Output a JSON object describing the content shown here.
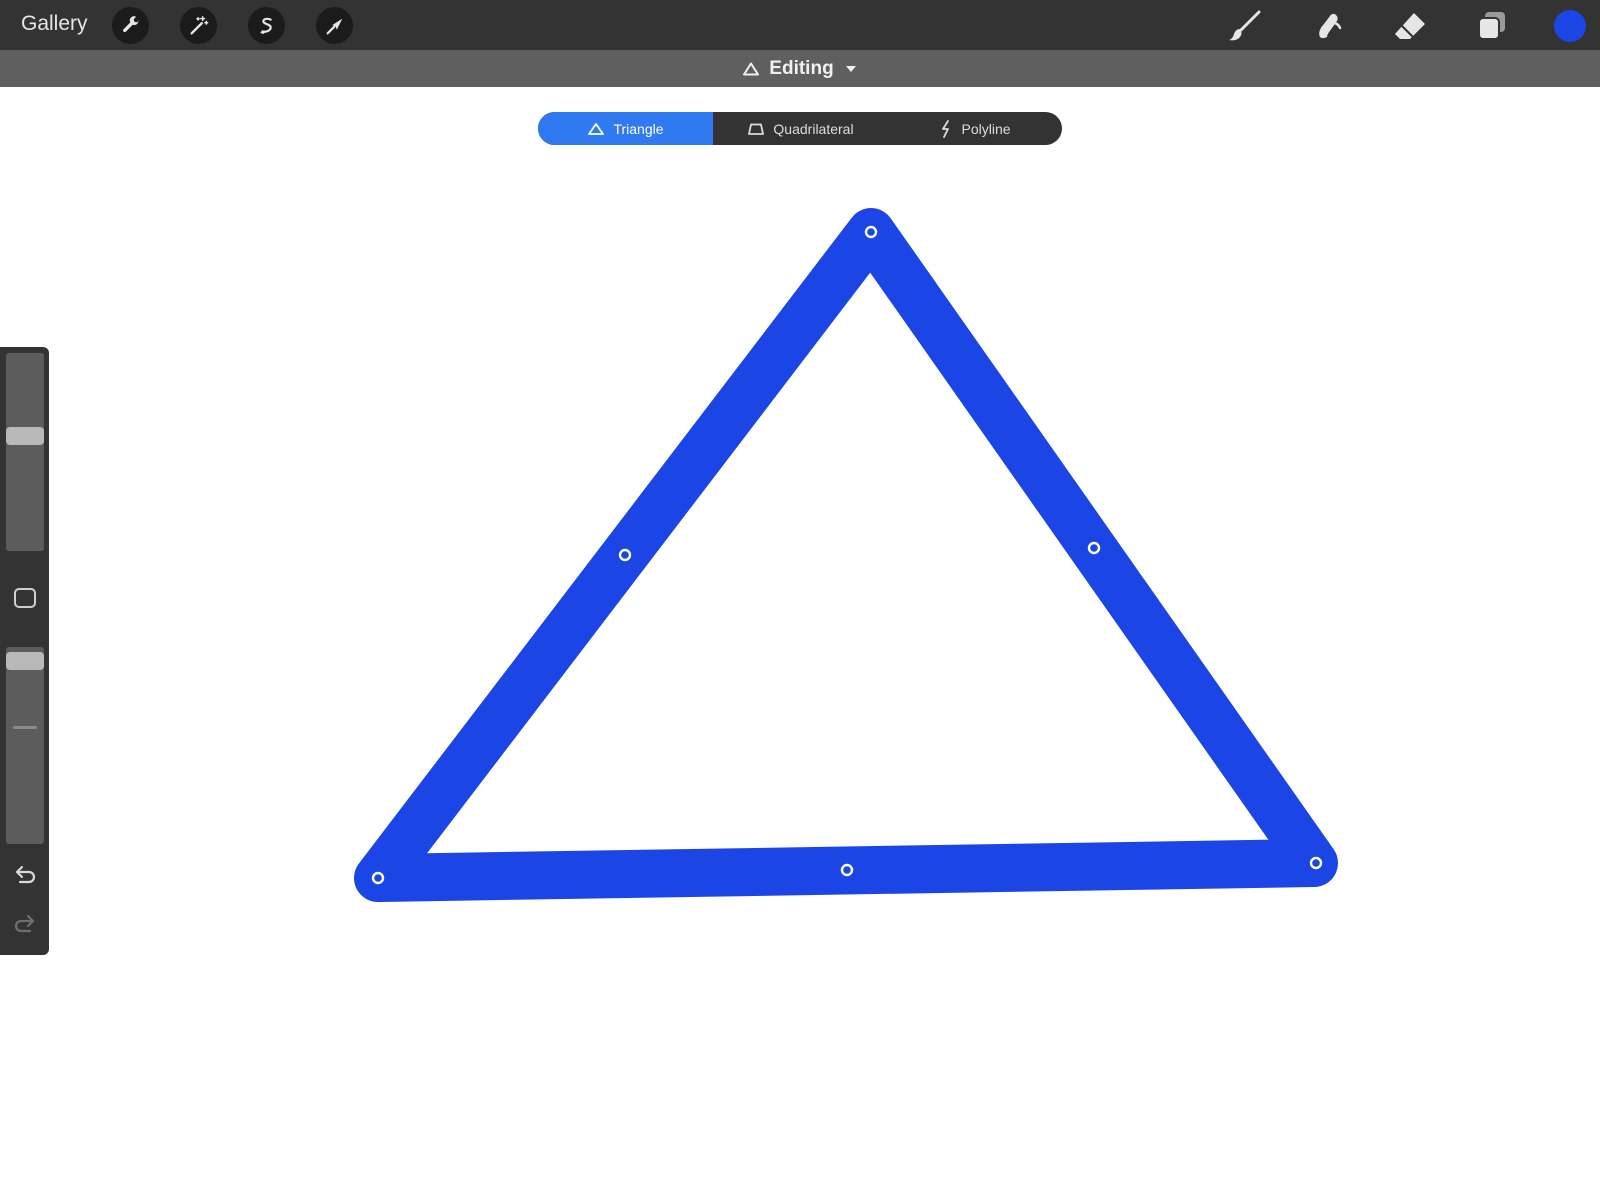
{
  "app": {
    "gallery_label": "Gallery"
  },
  "toolbar_left": [
    {
      "name": "wrench-icon"
    },
    {
      "name": "magic-wand-icon"
    },
    {
      "name": "selection-icon"
    },
    {
      "name": "transform-arrow-icon"
    }
  ],
  "toolbar_right": [
    {
      "name": "brush-icon"
    },
    {
      "name": "smudge-icon"
    },
    {
      "name": "eraser-icon"
    },
    {
      "name": "layers-icon"
    }
  ],
  "color": {
    "current": "#1c45e5",
    "stroke": "#1c45e5",
    "accent": "#2f7af0"
  },
  "editing": {
    "label": "Editing",
    "icon": "triangle-outline-icon",
    "dropdown_icon": "caret-down-icon"
  },
  "shape_modes": {
    "active_index": 0,
    "items": [
      {
        "label": "Triangle",
        "icon": "triangle-outline-icon"
      },
      {
        "label": "Quadrilateral",
        "icon": "quadrilateral-outline-icon"
      },
      {
        "label": "Polyline",
        "icon": "polyline-bolt-icon"
      }
    ]
  },
  "sidebar": {
    "brush_size_level": 0.59,
    "opacity_level": 0.97,
    "modify_button_icon": "square-outline-icon",
    "undo_icon": "undo-icon",
    "redo_icon": "redo-icon"
  }
}
